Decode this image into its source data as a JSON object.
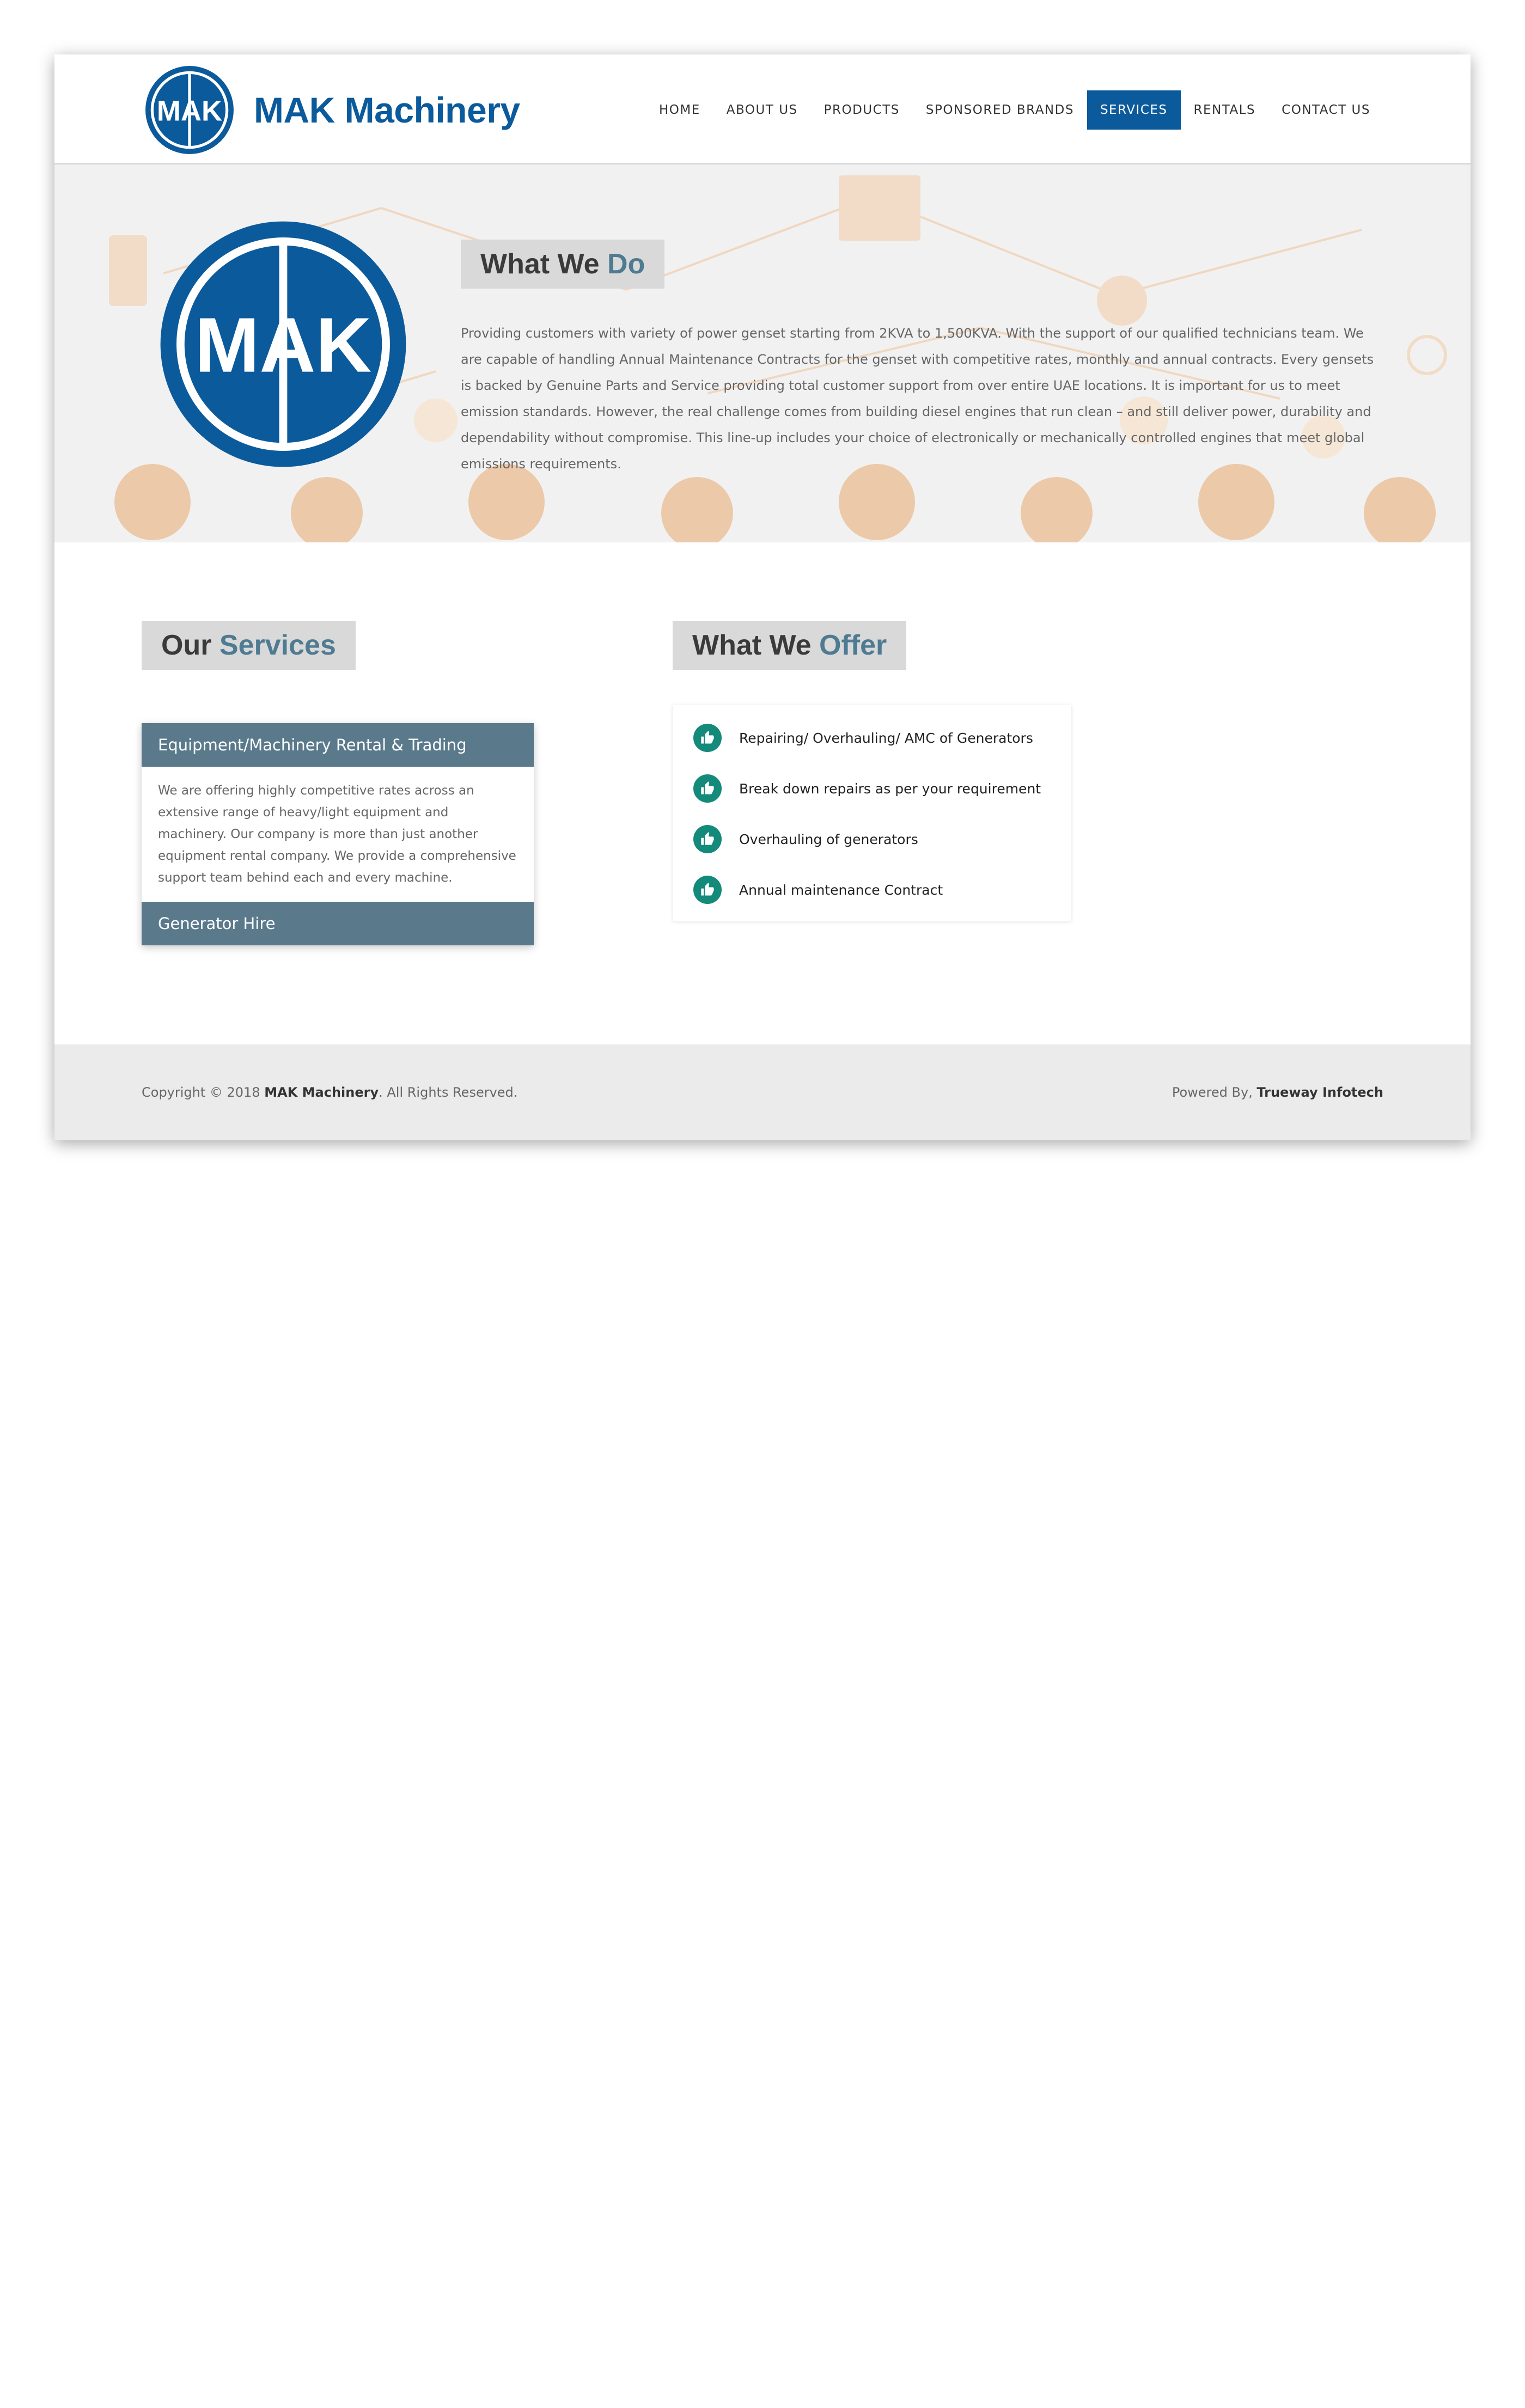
{
  "colors": {
    "brand_blue": "#0b5a9c",
    "accent_slate": "#4f7b92",
    "accordion_header": "#5a7a8c",
    "offer_icon": "#138a7a",
    "hero_bg": "#f1f1f1",
    "footer_bg": "#ebebeb"
  },
  "header": {
    "logo_text": "MAK",
    "brand_name": "MAK Machinery",
    "nav": [
      {
        "label": "HOME",
        "active": false
      },
      {
        "label": "ABOUT US",
        "active": false
      },
      {
        "label": "PRODUCTS",
        "active": false
      },
      {
        "label": "SPONSORED BRANDS",
        "active": false
      },
      {
        "label": "SERVICES",
        "active": true
      },
      {
        "label": "RENTALS",
        "active": false
      },
      {
        "label": "CONTACT US",
        "active": false
      }
    ]
  },
  "hero": {
    "logo_text": "MAK",
    "title_main": "What We ",
    "title_accent": "Do",
    "text": "Providing customers with variety of power genset starting from 2KVA to 1,500KVA. With the support of our qualified technicians team. We are capable of handling Annual Maintenance Contracts for the genset with competitive rates, monthly and annual contracts. Every gensets is backed by Genuine Parts and Service providing total customer support from over entire UAE locations. It is important for us to meet emission standards. However, the real challenge comes from building diesel engines that run clean – and still deliver power, durability and dependability without compromise. This line-up includes your choice of electronically or mechanically controlled engines that meet global emissions requirements."
  },
  "services": {
    "title_main": "Our ",
    "title_accent": "Services",
    "accordion": [
      {
        "heading": "Equipment/Machinery Rental & Trading",
        "expanded": true,
        "body": "We are offering highly competitive rates across an extensive range of heavy/light equipment and machinery. Our company is more than just another equipment rental company. We provide a comprehensive support team behind each and every machine."
      },
      {
        "heading": "Generator Hire",
        "expanded": false,
        "body": ""
      }
    ]
  },
  "offer": {
    "title_main": "What We ",
    "title_accent": "Offer",
    "icon": "thumbs-up-icon",
    "items": [
      "Repairing/ Overhauling/ AMC of Generators",
      "Break down repairs as per your requirement",
      "Overhauling of generators",
      "Annual maintenance Contract"
    ]
  },
  "footer": {
    "copyright_prefix": "Copyright © 2018 ",
    "company": "MAK Machinery",
    "copyright_suffix": ". All Rights Reserved.",
    "powered_prefix": "Powered By, ",
    "powered_by": "Trueway Infotech"
  }
}
